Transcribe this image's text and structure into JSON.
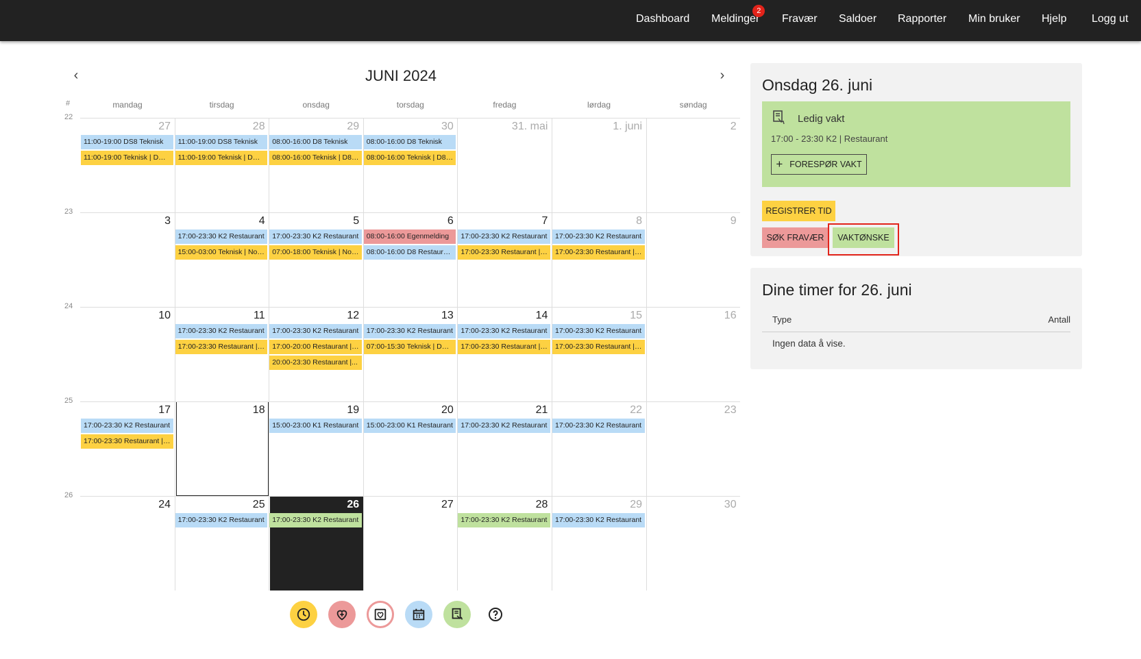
{
  "nav": {
    "items": [
      "Dashboard",
      "Meldinger",
      "Fravær",
      "Saldoer",
      "Rapporter",
      "Min bruker",
      "Hjelp",
      "Logg ut"
    ],
    "messages_badge": "2"
  },
  "calendar": {
    "title": "JUNI 2024",
    "week_header": "#",
    "weekdays": [
      "mandag",
      "tirsdag",
      "onsdag",
      "torsdag",
      "fredag",
      "lørdag",
      "søndag"
    ],
    "weeks": [
      {
        "num": "22",
        "days": [
          "27",
          "28",
          "29",
          "30",
          "31. mai",
          "1. juni",
          "2"
        ]
      },
      {
        "num": "23",
        "days": [
          "3",
          "4",
          "5",
          "6",
          "7",
          "8",
          "9"
        ]
      },
      {
        "num": "24",
        "days": [
          "10",
          "11",
          "12",
          "13",
          "14",
          "15",
          "16"
        ]
      },
      {
        "num": "25",
        "days": [
          "17",
          "18",
          "19",
          "20",
          "21",
          "22",
          "23"
        ]
      },
      {
        "num": "26",
        "days": [
          "24",
          "25",
          "26",
          "27",
          "28",
          "29",
          "30"
        ]
      }
    ],
    "events": [
      {
        "w": 0,
        "d": 0,
        "slot": 0,
        "color": "blue",
        "text": "11:00-19:00 DS8 Teknisk"
      },
      {
        "w": 0,
        "d": 0,
        "slot": 1,
        "color": "yellow",
        "text": "11:00-19:00 Teknisk | DS8 ..."
      },
      {
        "w": 0,
        "d": 1,
        "slot": 0,
        "color": "blue",
        "text": "11:00-19:00 DS8 Teknisk"
      },
      {
        "w": 0,
        "d": 1,
        "slot": 1,
        "color": "yellow",
        "text": "11:00-19:00 Teknisk | DS8 ..."
      },
      {
        "w": 0,
        "d": 2,
        "slot": 0,
        "color": "blue",
        "text": "08:00-16:00 D8 Teknisk"
      },
      {
        "w": 0,
        "d": 2,
        "slot": 1,
        "color": "yellow",
        "text": "08:00-16:00 Teknisk | D8 ..."
      },
      {
        "w": 0,
        "d": 3,
        "slot": 0,
        "color": "blue",
        "text": "08:00-16:00 D8 Teknisk"
      },
      {
        "w": 0,
        "d": 3,
        "slot": 1,
        "color": "yellow",
        "text": "08:00-16:00 Teknisk | D8 ..."
      },
      {
        "w": 1,
        "d": 1,
        "slot": 0,
        "color": "blue",
        "text": "17:00-23:30 K2 Restaurant"
      },
      {
        "w": 1,
        "d": 1,
        "slot": 1,
        "color": "yellow",
        "text": "15:00-03:00 Teknisk | Nor..."
      },
      {
        "w": 1,
        "d": 2,
        "slot": 0,
        "color": "blue",
        "text": "17:00-23:30 K2 Restaurant"
      },
      {
        "w": 1,
        "d": 2,
        "slot": 1,
        "color": "yellow",
        "text": "07:00-18:00 Teknisk | Nor..."
      },
      {
        "w": 1,
        "d": 3,
        "slot": 0,
        "color": "red",
        "text": "08:00-16:00 Egenmelding"
      },
      {
        "w": 1,
        "d": 3,
        "slot": 1,
        "color": "blue",
        "text": "08:00-16:00 D8 Restaurant"
      },
      {
        "w": 1,
        "d": 4,
        "slot": 0,
        "color": "blue",
        "text": "17:00-23:30 K2 Restaurant"
      },
      {
        "w": 1,
        "d": 4,
        "slot": 1,
        "color": "yellow",
        "text": "17:00-23:30 Restaurant | ..."
      },
      {
        "w": 1,
        "d": 5,
        "slot": 0,
        "color": "blue",
        "text": "17:00-23:30 K2 Restaurant"
      },
      {
        "w": 1,
        "d": 5,
        "slot": 1,
        "color": "yellow",
        "text": "17:00-23:30 Restaurant | ..."
      },
      {
        "w": 2,
        "d": 1,
        "slot": 0,
        "color": "blue",
        "text": "17:00-23:30 K2 Restaurant"
      },
      {
        "w": 2,
        "d": 1,
        "slot": 1,
        "color": "yellow",
        "text": "17:00-23:30 Restaurant | ..."
      },
      {
        "w": 2,
        "d": 2,
        "slot": 0,
        "color": "blue",
        "text": "17:00-23:30 K2 Restaurant"
      },
      {
        "w": 2,
        "d": 2,
        "slot": 1,
        "color": "yellow",
        "text": "17:00-20:00 Restaurant | ..."
      },
      {
        "w": 2,
        "d": 2,
        "slot": 2,
        "color": "yellow",
        "text": "20:00-23:30 Restaurant |..."
      },
      {
        "w": 2,
        "d": 3,
        "slot": 0,
        "color": "blue",
        "text": "17:00-23:30 K2 Restaurant"
      },
      {
        "w": 2,
        "d": 3,
        "slot": 1,
        "color": "yellow",
        "text": "07:00-15:30 Teknisk | DS ..."
      },
      {
        "w": 2,
        "d": 4,
        "slot": 0,
        "color": "blue",
        "text": "17:00-23:30 K2 Restaurant"
      },
      {
        "w": 2,
        "d": 4,
        "slot": 1,
        "color": "yellow",
        "text": "17:00-23:30 Restaurant | ..."
      },
      {
        "w": 2,
        "d": 5,
        "slot": 0,
        "color": "blue",
        "text": "17:00-23:30 K2 Restaurant"
      },
      {
        "w": 2,
        "d": 5,
        "slot": 1,
        "color": "yellow",
        "text": "17:00-23:30 Restaurant | ..."
      },
      {
        "w": 3,
        "d": 0,
        "slot": 0,
        "color": "blue",
        "text": "17:00-23:30 K2 Restaurant"
      },
      {
        "w": 3,
        "d": 0,
        "slot": 1,
        "color": "yellow",
        "text": "17:00-23:30 Restaurant | ..."
      },
      {
        "w": 3,
        "d": 2,
        "slot": 0,
        "color": "blue",
        "text": "15:00-23:00 K1 Restaurant"
      },
      {
        "w": 3,
        "d": 3,
        "slot": 0,
        "color": "blue",
        "text": "15:00-23:00 K1 Restaurant"
      },
      {
        "w": 3,
        "d": 4,
        "slot": 0,
        "color": "blue",
        "text": "17:00-23:30 K2 Restaurant"
      },
      {
        "w": 3,
        "d": 5,
        "slot": 0,
        "color": "blue",
        "text": "17:00-23:30 K2 Restaurant"
      },
      {
        "w": 4,
        "d": 1,
        "slot": 0,
        "color": "blue",
        "text": "17:00-23:30 K2 Restaurant"
      },
      {
        "w": 4,
        "d": 2,
        "slot": 0,
        "color": "green",
        "text": "17:00-23:30 K2 Restaurant"
      },
      {
        "w": 4,
        "d": 4,
        "slot": 0,
        "color": "green",
        "text": "17:00-23:30 K2 Restaurant"
      },
      {
        "w": 4,
        "d": 5,
        "slot": 0,
        "color": "blue",
        "text": "17:00-23:30 K2 Restaurant"
      }
    ]
  },
  "bottom_icons": [
    {
      "name": "clock-icon",
      "color": "#fdd142"
    },
    {
      "name": "heart-plus-icon",
      "color": "#ec9999"
    },
    {
      "name": "heart-calendar-icon",
      "color": "#ffffff"
    },
    {
      "name": "calendar-icon",
      "color": "#b9dbf6"
    },
    {
      "name": "shift-swap-icon",
      "color": "#bfe19e"
    },
    {
      "name": "help-icon",
      "color": "#ffffff"
    }
  ],
  "day_panel": {
    "title": "Onsdag 26. juni",
    "shift": {
      "title": "Ledig vakt",
      "detail": "17:00 - 23:30 K2 | Restaurant",
      "request_button": "FORESPØR VAKT"
    },
    "register_button": "REGISTRER TID",
    "absence_button": "SØK FRAVÆR",
    "wish_button": "VAKTØNSKE"
  },
  "hours_panel": {
    "title": "Dine timer for 26. juni",
    "col_type": "Type",
    "col_count": "Antall",
    "empty": "Ingen data å vise."
  },
  "colors": {
    "blue": "#b9dbf6",
    "yellow": "#fdd142",
    "red": "#ec9999",
    "green": "#bfe19e",
    "nav": "#222222",
    "highlight": "#e2231a"
  }
}
